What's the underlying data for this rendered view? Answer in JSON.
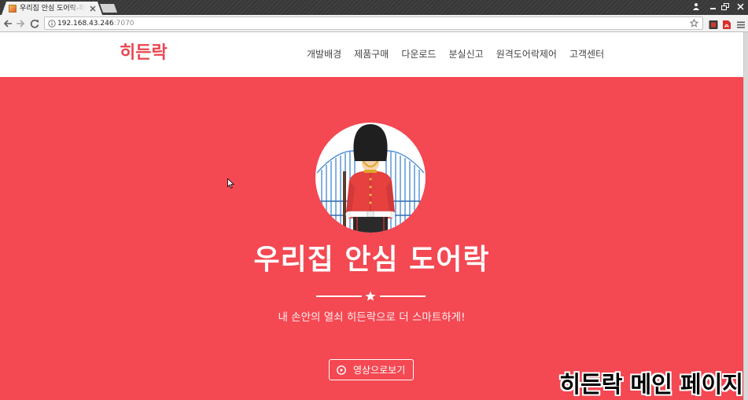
{
  "browser": {
    "tab": {
      "title": "우리집 안심 도어락-히든",
      "favicon": "site-favicon"
    },
    "address": {
      "host": "192.168.43.246",
      "port": ":7070"
    },
    "icons": {
      "tab_close": "close-icon",
      "new_tab": "new-tab-icon",
      "profile": "person-icon",
      "minimize": "minimize-icon",
      "restore": "restore-icon",
      "close_window": "close-icon",
      "back": "arrow-left-icon",
      "forward": "arrow-right-icon",
      "reload": "reload-icon",
      "site_info": "info-icon",
      "bookmark": "star-icon",
      "extension_1": "extension-icon",
      "extension_2": "pdf-icon",
      "menu": "menu-icon"
    }
  },
  "site": {
    "brand": "히든락",
    "nav": [
      {
        "label": "개발배경"
      },
      {
        "label": "제품구매"
      },
      {
        "label": "다운로드"
      },
      {
        "label": "분실신고"
      },
      {
        "label": "원격도어락제어"
      },
      {
        "label": "고객센터"
      }
    ],
    "hero": {
      "image": "queens-guard-illustration",
      "title": "우리집 안심 도어락",
      "divider_icon": "star-icon",
      "subtitle": "내 손안의 열쇠 히든락으로 더 스마트하게!",
      "button_icon": "play-circle-icon",
      "button_label": "영상으로보기"
    }
  },
  "video_caption": "히든락 메인 페이지",
  "colors": {
    "brand": "#e8464f",
    "hero_background": "#f44852",
    "hero_text": "#ffffff",
    "nav_text": "#454545",
    "caption_text": "#000000"
  }
}
